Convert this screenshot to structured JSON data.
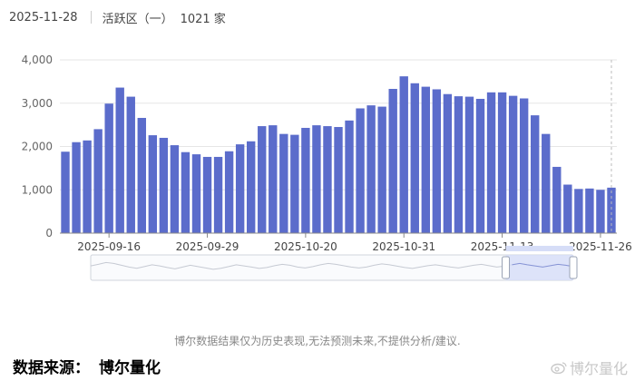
{
  "header": {
    "date": "2025-11-28",
    "region": "活跃区（一）",
    "count": "1021 家"
  },
  "footer": {
    "disclaimer": "博尔数据结果仅为历史表现,无法预测未来,不提供分析/建议.",
    "source_label": "数据来源：",
    "source_name": "博尔量化",
    "watermark": "博尔量化"
  },
  "colors": {
    "bar": "#5b6ccb",
    "slider_fill": "#d6ddf7",
    "slider_line": "#8794d6",
    "axis": "#999999",
    "grid": "#e6e6e6"
  },
  "chart_data": {
    "type": "bar",
    "categories": [
      "2025-09-10",
      "2025-09-11",
      "2025-09-12",
      "2025-09-15",
      "2025-09-16",
      "2025-09-17",
      "2025-09-18",
      "2025-09-19",
      "2025-09-22",
      "2025-09-23",
      "2025-09-24",
      "2025-09-25",
      "2025-09-26",
      "2025-09-29",
      "2025-09-30",
      "2025-10-09",
      "2025-10-10",
      "2025-10-13",
      "2025-10-14",
      "2025-10-15",
      "2025-10-16",
      "2025-10-17",
      "2025-10-20",
      "2025-10-21",
      "2025-10-22",
      "2025-10-23",
      "2025-10-24",
      "2025-10-27",
      "2025-10-28",
      "2025-10-29",
      "2025-10-30",
      "2025-10-31",
      "2025-11-03",
      "2025-11-04",
      "2025-11-05",
      "2025-11-06",
      "2025-11-07",
      "2025-11-10",
      "2025-11-11",
      "2025-11-12",
      "2025-11-13",
      "2025-11-14",
      "2025-11-17",
      "2025-11-18",
      "2025-11-19",
      "2025-11-20",
      "2025-11-21",
      "2025-11-24",
      "2025-11-25",
      "2025-11-26",
      "2025-11-27"
    ],
    "values": [
      1880,
      2100,
      2140,
      2400,
      2990,
      3360,
      3150,
      2660,
      2260,
      2200,
      2030,
      1870,
      1820,
      1760,
      1760,
      1890,
      2050,
      2120,
      2470,
      2490,
      2290,
      2270,
      2430,
      2490,
      2470,
      2450,
      2600,
      2880,
      2950,
      2920,
      3330,
      3620,
      3460,
      3380,
      3320,
      3210,
      3160,
      3150,
      3100,
      3250,
      3250,
      3170,
      3110,
      2720,
      2290,
      1530,
      1120,
      1020,
      1030,
      1000,
      1050
    ],
    "tick_labels": [
      {
        "index": 4,
        "label": "2025-09-16"
      },
      {
        "index": 13,
        "label": "2025-09-29"
      },
      {
        "index": 22,
        "label": "2025-10-20"
      },
      {
        "index": 31,
        "label": "2025-10-31"
      },
      {
        "index": 40,
        "label": "2025-11-13"
      },
      {
        "index": 49,
        "label": "2025-11-26"
      }
    ],
    "yticks": [
      "0",
      "1,000",
      "2,000",
      "3,000",
      "4,000"
    ],
    "ylim": [
      0,
      4000
    ],
    "grid": true,
    "slider": {
      "overview": [
        0.55,
        0.62,
        0.7,
        0.66,
        0.58,
        0.5,
        0.45,
        0.52,
        0.6,
        0.55,
        0.48,
        0.42,
        0.5,
        0.58,
        0.52,
        0.46,
        0.4,
        0.45,
        0.52,
        0.6,
        0.55,
        0.5,
        0.44,
        0.48,
        0.56,
        0.62,
        0.58,
        0.5,
        0.46,
        0.52,
        0.6,
        0.66,
        0.62,
        0.56,
        0.5,
        0.46,
        0.5,
        0.58,
        0.64,
        0.6,
        0.54,
        0.48,
        0.44,
        0.5,
        0.56,
        0.6,
        0.55,
        0.5,
        0.46,
        0.52,
        0.58,
        0.62,
        0.56,
        0.5,
        0.54,
        0.6,
        0.66,
        0.6,
        0.55,
        0.5,
        0.56,
        0.62,
        0.58,
        0.52
      ],
      "selected_start": 0.86,
      "selected_end": 1.0
    }
  }
}
